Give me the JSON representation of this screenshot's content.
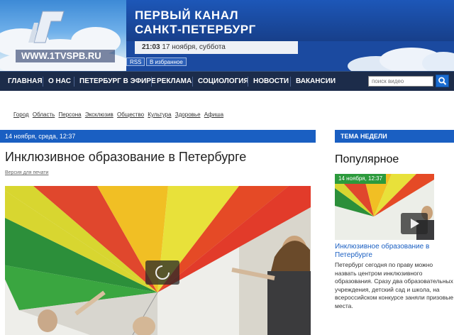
{
  "header": {
    "site_url": "WWW.1TVSPB.RU",
    "channel_line1": "ПЕРВЫЙ КАНАЛ",
    "channel_line2": "САНКТ-ПЕТЕРБУРГ",
    "time": "21:03",
    "date": "17 ноября, суббота",
    "rss": "RSS",
    "bookmark": "В избранное"
  },
  "nav": {
    "items": [
      "ГЛАВНАЯ",
      "О НАС",
      "ПЕТЕРБУРГ В ЭФИРЕ",
      "РЕКЛАМА",
      "СОЦИОЛОГИЯ",
      "НОВОСТИ",
      "ВАКАНСИИ"
    ],
    "search_placeholder": "поиск видео"
  },
  "subnav": {
    "items": [
      "Город",
      "Область",
      "Персона",
      "Эксклюзив",
      "Общество",
      "Культура",
      "Здоровье",
      "Афиша"
    ]
  },
  "article": {
    "date_bar": "14 ноября, среда, 12:37",
    "title": "Инклюзивное образование в Петербурге",
    "print_link": "Версия для печати"
  },
  "sidebar": {
    "bar_title": "ТЕМА НЕДЕЛИ",
    "popular_title": "Популярное",
    "thumb_date": "14 ноября, 12:37",
    "link": "Инклюзивное образование в Петербурге",
    "text": "Петербург сегодня по праву можно назвать центром инклюзивного образования. Сразу два образовательных учреждения, детский сад и школа, на всероссийском конкурсе заняли призовые места."
  },
  "colors": {
    "accent": "#1a5fc2",
    "nav_bg": "#1c2c4a",
    "thumb_badge": "#2c9a3c"
  }
}
